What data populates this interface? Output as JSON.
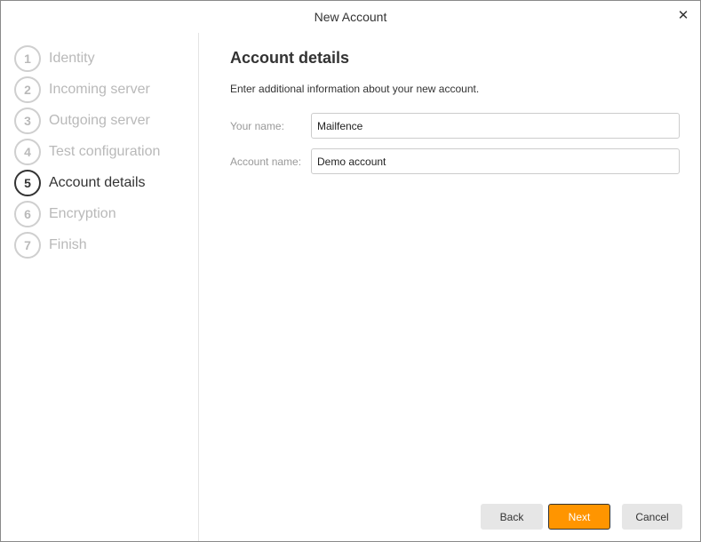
{
  "window": {
    "title": "New Account",
    "close_glyph": "✕"
  },
  "steps": [
    {
      "number": "1",
      "label": "Identity",
      "state": "inactive"
    },
    {
      "number": "2",
      "label": "Incoming server",
      "state": "inactive"
    },
    {
      "number": "3",
      "label": "Outgoing server",
      "state": "inactive"
    },
    {
      "number": "4",
      "label": "Test configuration",
      "state": "inactive"
    },
    {
      "number": "5",
      "label": "Account details",
      "state": "active"
    },
    {
      "number": "6",
      "label": "Encryption",
      "state": "inactive"
    },
    {
      "number": "7",
      "label": "Finish",
      "state": "inactive"
    }
  ],
  "main": {
    "heading": "Account details",
    "intro": "Enter additional information about your new account.",
    "fields": {
      "your_name": {
        "label": "Your name:",
        "value": "Mailfence"
      },
      "account_name": {
        "label": "Account name:",
        "value": "Demo account"
      }
    }
  },
  "buttons": {
    "back": "Back",
    "next": "Next",
    "cancel": "Cancel"
  },
  "colors": {
    "accent": "#ff9500",
    "inactive_text": "#b9b9b9",
    "active_text": "#333333"
  }
}
